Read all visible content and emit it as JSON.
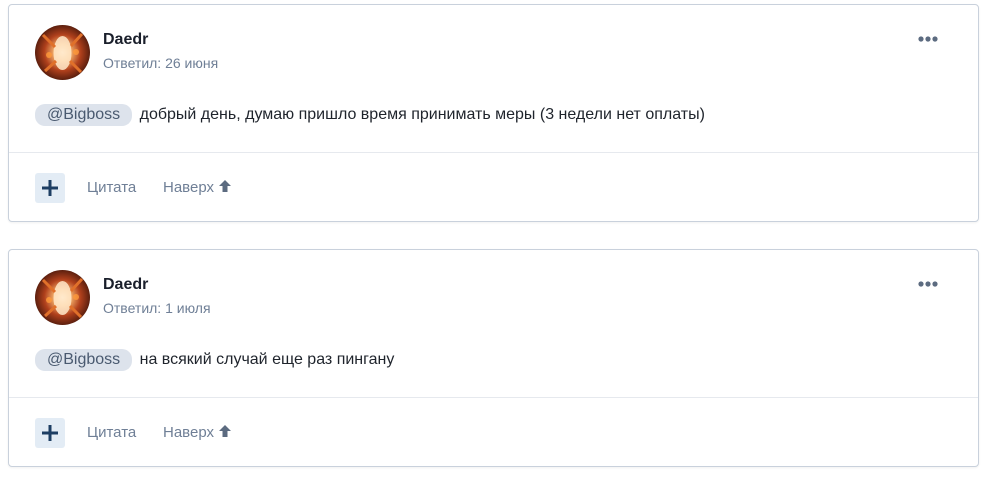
{
  "posts": [
    {
      "author": "Daedr",
      "meta": "Ответил: 26 июня",
      "mention": "@Bigboss",
      "text": "добрый день, думаю пришло время принимать меры (3 недели нет оплаты)",
      "quote_label": "Цитата",
      "top_label": "Наверх"
    },
    {
      "author": "Daedr",
      "meta": "Ответил: 1 июля",
      "mention": "@Bigboss",
      "text": "на всякий случай еще раз пингану",
      "quote_label": "Цитата",
      "top_label": "Наверх"
    }
  ],
  "icons": {
    "more": "more-dots-icon",
    "react": "plus-icon",
    "top": "arrow-up-icon",
    "avatar": "avatar-image"
  },
  "colors": {
    "border": "#c9d1dc",
    "muted_text": "#6f7f96",
    "mention_bg": "#dde3ec",
    "react_bg": "#e3ecf5",
    "react_plus": "#1d3e63"
  }
}
